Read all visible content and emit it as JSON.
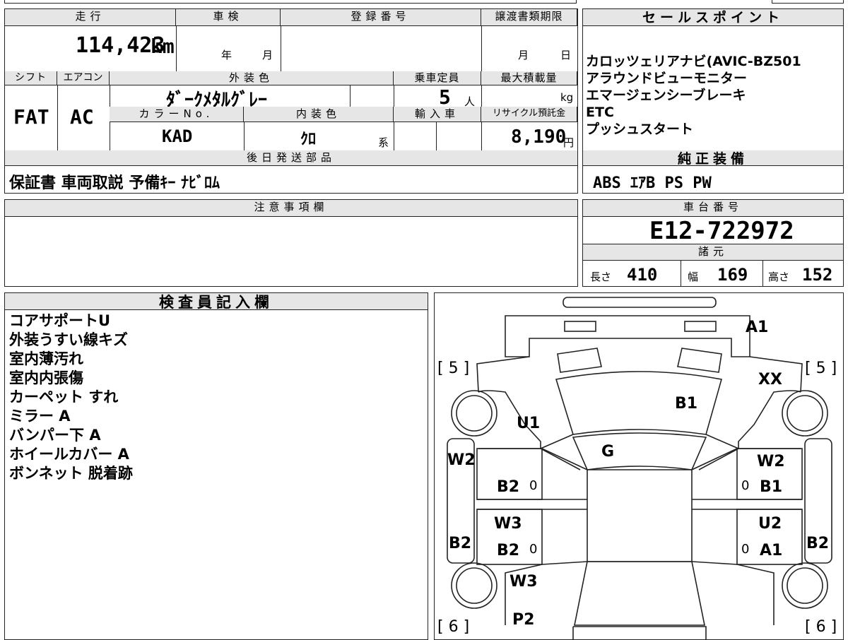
{
  "headers": {
    "mileage": "走行",
    "inspection": "車検",
    "registration": "登録番号",
    "transfer_deadline": "譲渡書類期限",
    "sales_point": "セールスポイント",
    "shift": "シフト",
    "aircon": "エアコン",
    "exterior_color": "外装色",
    "capacity": "乗車定員",
    "max_load": "最大積載量",
    "color_no": "カラーNo.",
    "interior_color": "内装色",
    "import": "輸入車",
    "recycle": "リサイクル預託金",
    "later_parts": "後日発送部品",
    "genuine_equipment": "純正装備",
    "notes": "注意事項欄",
    "chassis_no": "車台番号",
    "specs": "諸元",
    "inspector": "検査員記入欄"
  },
  "values": {
    "mileage": "114,423",
    "mileage_unit": "km",
    "year_unit": "年",
    "month_unit": "月",
    "deadline_month": "月",
    "deadline_day": "日",
    "shift": "FAT",
    "aircon": "AC",
    "exterior_color": "ﾀﾞｰｸﾒﾀﾙｸﾞﾚｰ",
    "capacity": "5",
    "capacity_unit": "人",
    "max_load_unit": "kg",
    "color_no": "KAD",
    "interior_color": "ｸﾛ",
    "interior_suffix": "系",
    "recycle": "8,190",
    "recycle_unit": "円",
    "later_parts": "保証書 車両取説 予備ｷｰ ﾅﾋﾞﾛﾑ",
    "genuine_equipment": "ABS ｴｱB PS PW",
    "chassis_no": "E12-722972",
    "length_label": "長さ",
    "length": "410",
    "width_label": "幅",
    "width": "169",
    "height_label": "高さ",
    "height": "152"
  },
  "sales_points": [
    "カロッツェリアナビ(AVIC-BZ501",
    "アラウンドビューモニター",
    "エマージェンシーブレーキ",
    "ETC",
    "プッシュスタート"
  ],
  "inspector_notes": [
    "コアサポートU",
    "外装うすい線キズ",
    "室内薄汚れ",
    "室内内張傷",
    "カーペット すれ",
    "ミラー A",
    "バンパー下 A",
    "ホイールカバー A",
    "ボンネット 脱着跡"
  ],
  "diagram": {
    "tire_fl": "[ 5 ]",
    "tire_fr": "[ 5 ]",
    "tire_rl": "[ 6 ]",
    "tire_rr": "[ 6 ]",
    "a1_front": "A1",
    "xx": "XX",
    "b1_hood": "B1",
    "u1": "U1",
    "g": "G",
    "w2_left": "W2",
    "w2_right": "W2",
    "b2_door_l": "B2",
    "b1_door_r": "B1",
    "w3_door_l": "W3",
    "u2": "U2",
    "b2_side_l": "B2",
    "b2_side_r": "B2",
    "b2_door_l2": "B2",
    "a1_door_r": "A1",
    "w3_rear": "W3",
    "p2": "P2",
    "zero1": "0",
    "zero2": "0",
    "zero3": "0",
    "zero4": "0"
  }
}
